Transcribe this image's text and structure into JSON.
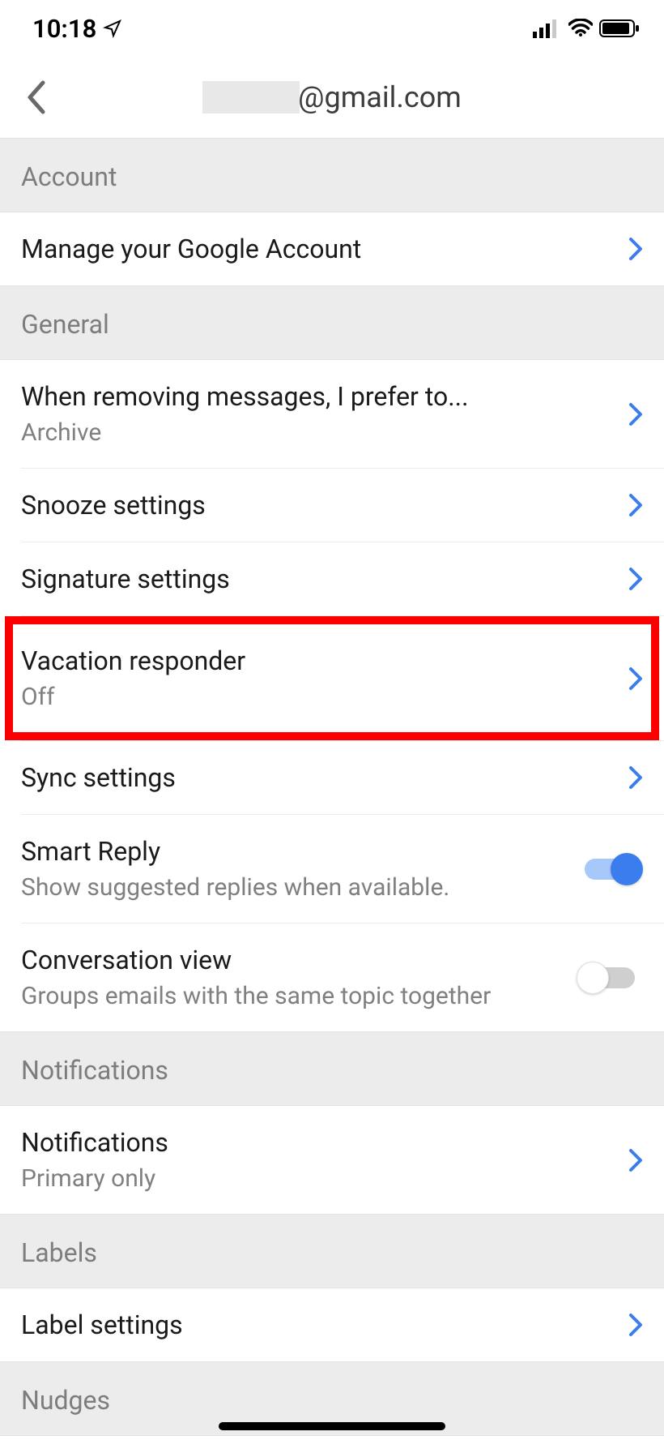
{
  "status": {
    "time": "10:18"
  },
  "header": {
    "email_domain": "@gmail.com"
  },
  "sections": {
    "account": {
      "title": "Account"
    },
    "general": {
      "title": "General"
    },
    "notifications": {
      "title": "Notifications"
    },
    "labels": {
      "title": "Labels"
    },
    "nudges": {
      "title": "Nudges"
    }
  },
  "rows": {
    "manage_account": {
      "title": "Manage your Google Account"
    },
    "remove_pref": {
      "title": "When removing messages, I prefer to...",
      "sub": "Archive"
    },
    "snooze": {
      "title": "Snooze settings"
    },
    "signature": {
      "title": "Signature settings"
    },
    "vacation": {
      "title": "Vacation responder",
      "sub": "Off"
    },
    "sync": {
      "title": "Sync settings"
    },
    "smart_reply": {
      "title": "Smart Reply",
      "sub": "Show suggested replies when available."
    },
    "conversation": {
      "title": "Conversation view",
      "sub": "Groups emails with the same topic together"
    },
    "notifications_row": {
      "title": "Notifications",
      "sub": "Primary only"
    },
    "label_settings": {
      "title": "Label settings"
    }
  }
}
